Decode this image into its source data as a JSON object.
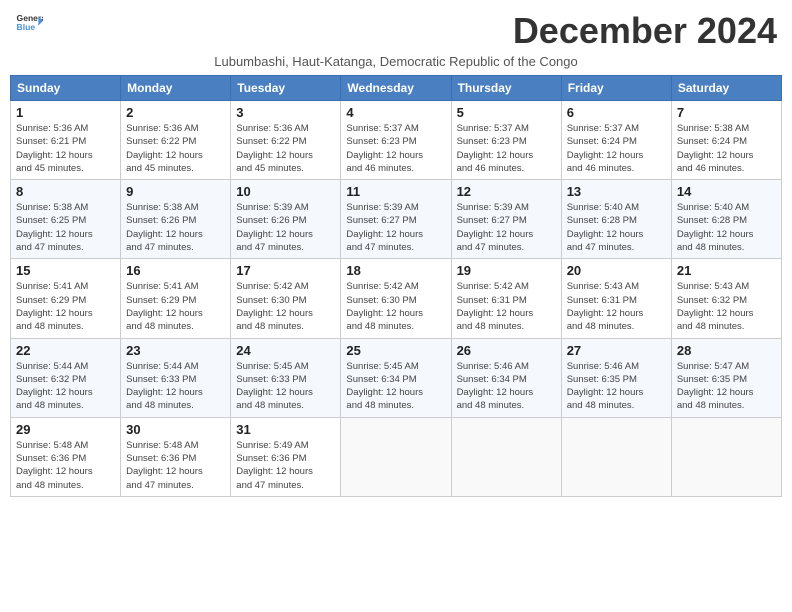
{
  "header": {
    "logo_line1": "General",
    "logo_line2": "Blue",
    "month_title": "December 2024",
    "subtitle": "Lubumbashi, Haut-Katanga, Democratic Republic of the Congo"
  },
  "weekdays": [
    "Sunday",
    "Monday",
    "Tuesday",
    "Wednesday",
    "Thursday",
    "Friday",
    "Saturday"
  ],
  "weeks": [
    [
      {
        "day": "1",
        "info": "Sunrise: 5:36 AM\nSunset: 6:21 PM\nDaylight: 12 hours\nand 45 minutes."
      },
      {
        "day": "2",
        "info": "Sunrise: 5:36 AM\nSunset: 6:22 PM\nDaylight: 12 hours\nand 45 minutes."
      },
      {
        "day": "3",
        "info": "Sunrise: 5:36 AM\nSunset: 6:22 PM\nDaylight: 12 hours\nand 45 minutes."
      },
      {
        "day": "4",
        "info": "Sunrise: 5:37 AM\nSunset: 6:23 PM\nDaylight: 12 hours\nand 46 minutes."
      },
      {
        "day": "5",
        "info": "Sunrise: 5:37 AM\nSunset: 6:23 PM\nDaylight: 12 hours\nand 46 minutes."
      },
      {
        "day": "6",
        "info": "Sunrise: 5:37 AM\nSunset: 6:24 PM\nDaylight: 12 hours\nand 46 minutes."
      },
      {
        "day": "7",
        "info": "Sunrise: 5:38 AM\nSunset: 6:24 PM\nDaylight: 12 hours\nand 46 minutes."
      }
    ],
    [
      {
        "day": "8",
        "info": "Sunrise: 5:38 AM\nSunset: 6:25 PM\nDaylight: 12 hours\nand 47 minutes."
      },
      {
        "day": "9",
        "info": "Sunrise: 5:38 AM\nSunset: 6:26 PM\nDaylight: 12 hours\nand 47 minutes."
      },
      {
        "day": "10",
        "info": "Sunrise: 5:39 AM\nSunset: 6:26 PM\nDaylight: 12 hours\nand 47 minutes."
      },
      {
        "day": "11",
        "info": "Sunrise: 5:39 AM\nSunset: 6:27 PM\nDaylight: 12 hours\nand 47 minutes."
      },
      {
        "day": "12",
        "info": "Sunrise: 5:39 AM\nSunset: 6:27 PM\nDaylight: 12 hours\nand 47 minutes."
      },
      {
        "day": "13",
        "info": "Sunrise: 5:40 AM\nSunset: 6:28 PM\nDaylight: 12 hours\nand 47 minutes."
      },
      {
        "day": "14",
        "info": "Sunrise: 5:40 AM\nSunset: 6:28 PM\nDaylight: 12 hours\nand 48 minutes."
      }
    ],
    [
      {
        "day": "15",
        "info": "Sunrise: 5:41 AM\nSunset: 6:29 PM\nDaylight: 12 hours\nand 48 minutes."
      },
      {
        "day": "16",
        "info": "Sunrise: 5:41 AM\nSunset: 6:29 PM\nDaylight: 12 hours\nand 48 minutes."
      },
      {
        "day": "17",
        "info": "Sunrise: 5:42 AM\nSunset: 6:30 PM\nDaylight: 12 hours\nand 48 minutes."
      },
      {
        "day": "18",
        "info": "Sunrise: 5:42 AM\nSunset: 6:30 PM\nDaylight: 12 hours\nand 48 minutes."
      },
      {
        "day": "19",
        "info": "Sunrise: 5:42 AM\nSunset: 6:31 PM\nDaylight: 12 hours\nand 48 minutes."
      },
      {
        "day": "20",
        "info": "Sunrise: 5:43 AM\nSunset: 6:31 PM\nDaylight: 12 hours\nand 48 minutes."
      },
      {
        "day": "21",
        "info": "Sunrise: 5:43 AM\nSunset: 6:32 PM\nDaylight: 12 hours\nand 48 minutes."
      }
    ],
    [
      {
        "day": "22",
        "info": "Sunrise: 5:44 AM\nSunset: 6:32 PM\nDaylight: 12 hours\nand 48 minutes."
      },
      {
        "day": "23",
        "info": "Sunrise: 5:44 AM\nSunset: 6:33 PM\nDaylight: 12 hours\nand 48 minutes."
      },
      {
        "day": "24",
        "info": "Sunrise: 5:45 AM\nSunset: 6:33 PM\nDaylight: 12 hours\nand 48 minutes."
      },
      {
        "day": "25",
        "info": "Sunrise: 5:45 AM\nSunset: 6:34 PM\nDaylight: 12 hours\nand 48 minutes."
      },
      {
        "day": "26",
        "info": "Sunrise: 5:46 AM\nSunset: 6:34 PM\nDaylight: 12 hours\nand 48 minutes."
      },
      {
        "day": "27",
        "info": "Sunrise: 5:46 AM\nSunset: 6:35 PM\nDaylight: 12 hours\nand 48 minutes."
      },
      {
        "day": "28",
        "info": "Sunrise: 5:47 AM\nSunset: 6:35 PM\nDaylight: 12 hours\nand 48 minutes."
      }
    ],
    [
      {
        "day": "29",
        "info": "Sunrise: 5:48 AM\nSunset: 6:36 PM\nDaylight: 12 hours\nand 48 minutes."
      },
      {
        "day": "30",
        "info": "Sunrise: 5:48 AM\nSunset: 6:36 PM\nDaylight: 12 hours\nand 47 minutes."
      },
      {
        "day": "31",
        "info": "Sunrise: 5:49 AM\nSunset: 6:36 PM\nDaylight: 12 hours\nand 47 minutes."
      },
      {
        "day": "",
        "info": ""
      },
      {
        "day": "",
        "info": ""
      },
      {
        "day": "",
        "info": ""
      },
      {
        "day": "",
        "info": ""
      }
    ]
  ]
}
